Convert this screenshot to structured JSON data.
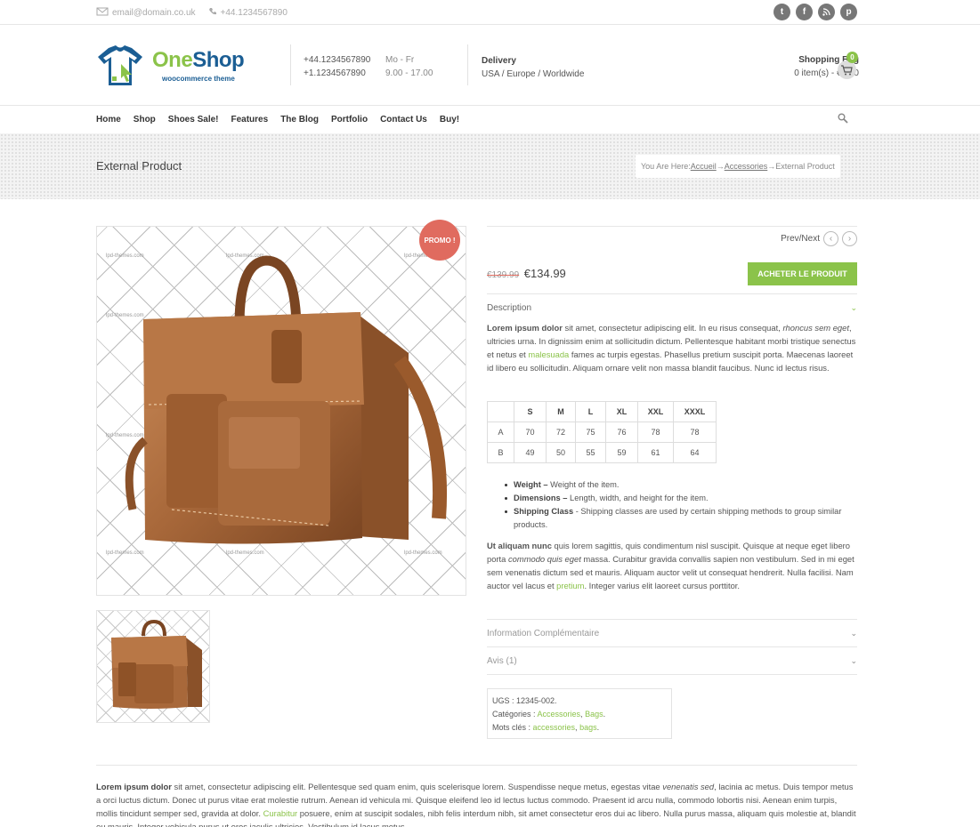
{
  "topbar": {
    "email": "email@domain.co.uk",
    "phone": "+44.1234567890",
    "social": [
      "twitter-icon",
      "facebook-icon",
      "rss-icon",
      "pinterest-icon"
    ]
  },
  "header": {
    "brand_one": "One",
    "brand_shop": "Shop",
    "tagline": "woocommerce theme",
    "phone1": "+44.1234567890",
    "phone2": "+1.1234567890",
    "hours_days": "Mo - Fr",
    "hours_time": "9.00 - 17.00",
    "delivery_title": "Delivery",
    "delivery_regions": "USA / Europe / Worldwide",
    "bag_title": "Shopping Bag",
    "bag_summary": "0 item(s) - €0.00",
    "cart_count": "0"
  },
  "nav": {
    "items": [
      "Home",
      "Shop",
      "Shoes Sale!",
      "Features",
      "The Blog",
      "Portfolio",
      "Contact Us",
      "Buy!"
    ]
  },
  "page": {
    "title": "External Product",
    "breadcrumb_prefix": "You Are Here: ",
    "breadcrumb_home": "Accueil",
    "breadcrumb_cat": "Accessories",
    "breadcrumb_current": "External Product",
    "arrow": " → "
  },
  "product": {
    "promo": "PROMO !",
    "prevnext": "Prev/Next",
    "old_price": "€139.99",
    "price": "€134.99",
    "buy_label": "ACHETER LE PRODUIT",
    "watermark": "lpd-themes.com"
  },
  "tabs": {
    "description": "Description",
    "info": "Information Complémentaire",
    "reviews": "Avis (1)"
  },
  "description": {
    "p1_bold": "Lorem ipsum dolor",
    "p1_a": " sit amet, consectetur adipiscing elit. In eu risus consequat, ",
    "p1_italic": "rhoncus sem eget",
    "p1_b": ", ultricies urna. In dignissim enim at sollicitudin dictum. Pellentesque habitant morbi tristique senectus et netus et ",
    "p1_link": "malesuada",
    "p1_c": " fames ac turpis egestas. Phasellus pretium suscipit porta. Maecenas laoreet id libero eu sollicitudin. Aliquam ornare velit non massa blandit faucibus. Nunc id lectus risus.",
    "p2_bold": "Ut aliquam nunc",
    "p2_a": " quis lorem sagittis, quis condimentum nisl suscipit. Quisque at neque eget libero porta ",
    "p2_italic": "commodo quis eget",
    "p2_b": " massa. Curabitur gravida convallis sapien non vestibulum. Sed in mi eget sem venenatis dictum sed et mauris. Aliquam auctor velit ut consequat hendrerit. Nulla facilisi. Nam auctor vel lacus et ",
    "p2_link": "pretium",
    "p2_c": ". Integer varius elit laoreet cursus porttitor."
  },
  "size_table": {
    "headers": [
      "",
      "S",
      "M",
      "L",
      "XL",
      "XXL",
      "XXXL"
    ],
    "rows": [
      [
        "A",
        "70",
        "72",
        "75",
        "76",
        "78",
        "78"
      ],
      [
        "B",
        "49",
        "50",
        "55",
        "59",
        "61",
        "64"
      ]
    ]
  },
  "bullets": [
    {
      "label": "Weight –",
      "text": " Weight of the item."
    },
    {
      "label": "Dimensions –",
      "text": " Length, width, and height for the item."
    },
    {
      "label": "Shipping Class",
      "text": " - Shipping classes are used by certain shipping methods to group similar products."
    }
  ],
  "meta": {
    "sku": "UGS : 12345-002.",
    "cat_label": "Catégories : ",
    "cat1": "Accessories",
    "cat2": "Bags",
    "tag_label": "Mots clés : ",
    "tag1": "accessories",
    "tag2": "bags",
    "comma": ", ",
    "period": "."
  },
  "bottom": {
    "bold": "Lorem ipsum dolor",
    "a": " sit amet, consectetur adipiscing elit. Pellentesque sed quam enim, quis scelerisque lorem. Suspendisse neque metus, egestas vitae ",
    "italic": "venenatis sed",
    "b": ", lacinia ac metus. Duis tempor metus a orci luctus dictum. Donec ut purus vitae erat molestie rutrum. Aenean id vehicula mi. Quisque eleifend leo id lectus luctus commodo. Praesent id arcu nulla, commodo lobortis nisi. Aenean enim turpis, mollis tincidunt semper sed, gravida at dolor. ",
    "link": "Curabitur",
    "c": " posuere, enim at suscipit sodales, nibh felis interdum nibh, sit amet consectetur eros dui ac libero. Nulla purus massa, aliquam quis molestie at, blandit eu mauris. Integer vehicula purus ut eros iaculis ultricies. Vestibulum id lacus metus."
  },
  "colors": {
    "accent": "#8bc34a",
    "brand_blue": "#1b5e94",
    "promo": "#e06b5f"
  }
}
